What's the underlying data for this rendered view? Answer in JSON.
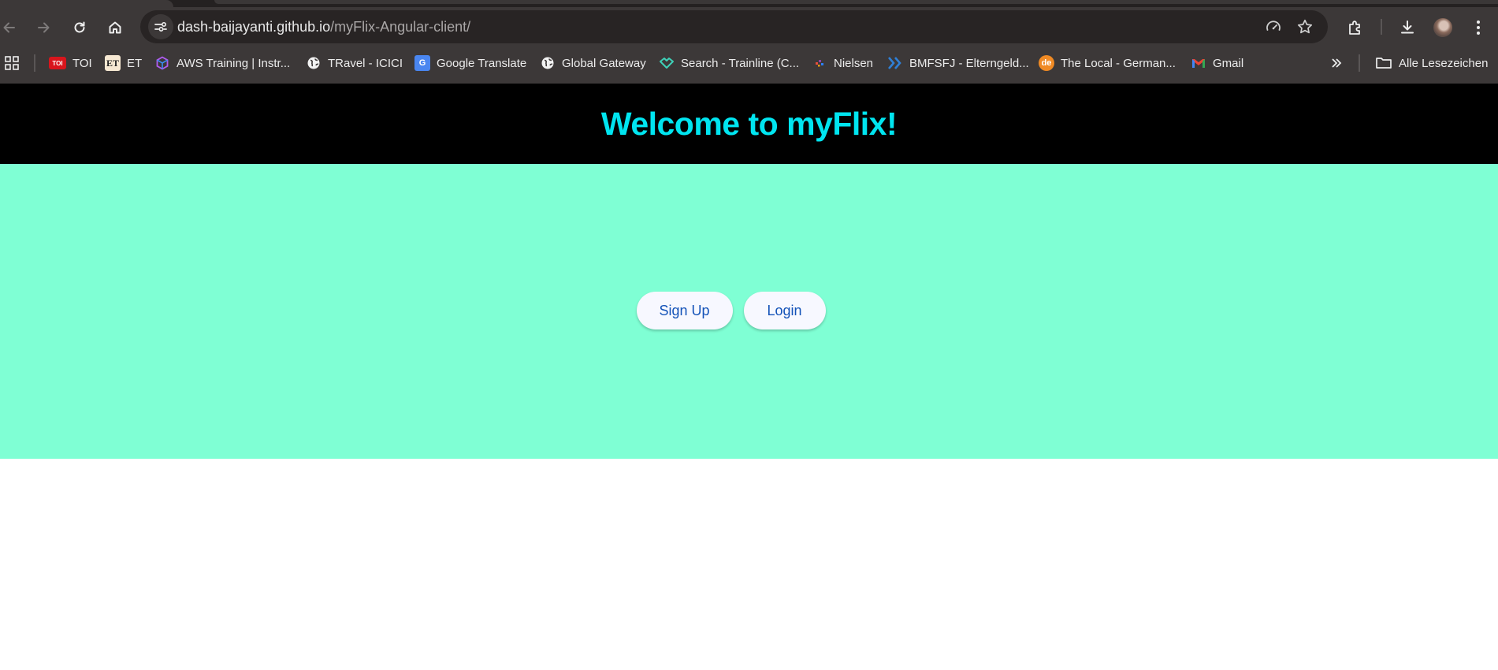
{
  "browser": {
    "url_domain": "dash-baijayanti.github.io",
    "url_path": "/myFlix-Angular-client/",
    "bookmarks": [
      {
        "label": "TOI",
        "icon": "toi-icon"
      },
      {
        "label": "ET",
        "icon": "et-icon"
      },
      {
        "label": "AWS Training | Instr...",
        "icon": "aws-cube-icon"
      },
      {
        "label": "TRavel - ICICI",
        "icon": "globe-icon"
      },
      {
        "label": "Google Translate",
        "icon": "google-translate-icon"
      },
      {
        "label": "Global Gateway",
        "icon": "globe-icon"
      },
      {
        "label": "Search - Trainline (C...",
        "icon": "trainline-icon"
      },
      {
        "label": "Nielsen",
        "icon": "nielsen-icon"
      },
      {
        "label": "BMFSFJ - Elterngeld...",
        "icon": "chevrons-icon"
      },
      {
        "label": "The Local - German...",
        "icon": "the-local-icon"
      },
      {
        "label": "Gmail",
        "icon": "gmail-icon"
      }
    ],
    "all_bookmarks_label": "Alle Lesezeichen",
    "toi_favicon_text": "TOI",
    "et_favicon_text": "ET",
    "thelocal_favicon_text": "de"
  },
  "page": {
    "title": "Welcome to myFlix!",
    "signup_label": "Sign Up",
    "login_label": "Login"
  },
  "colors": {
    "header_bg": "#000000",
    "title_color": "#00e5f0",
    "hero_bg": "#7fffd4",
    "button_text": "#1352b8"
  }
}
